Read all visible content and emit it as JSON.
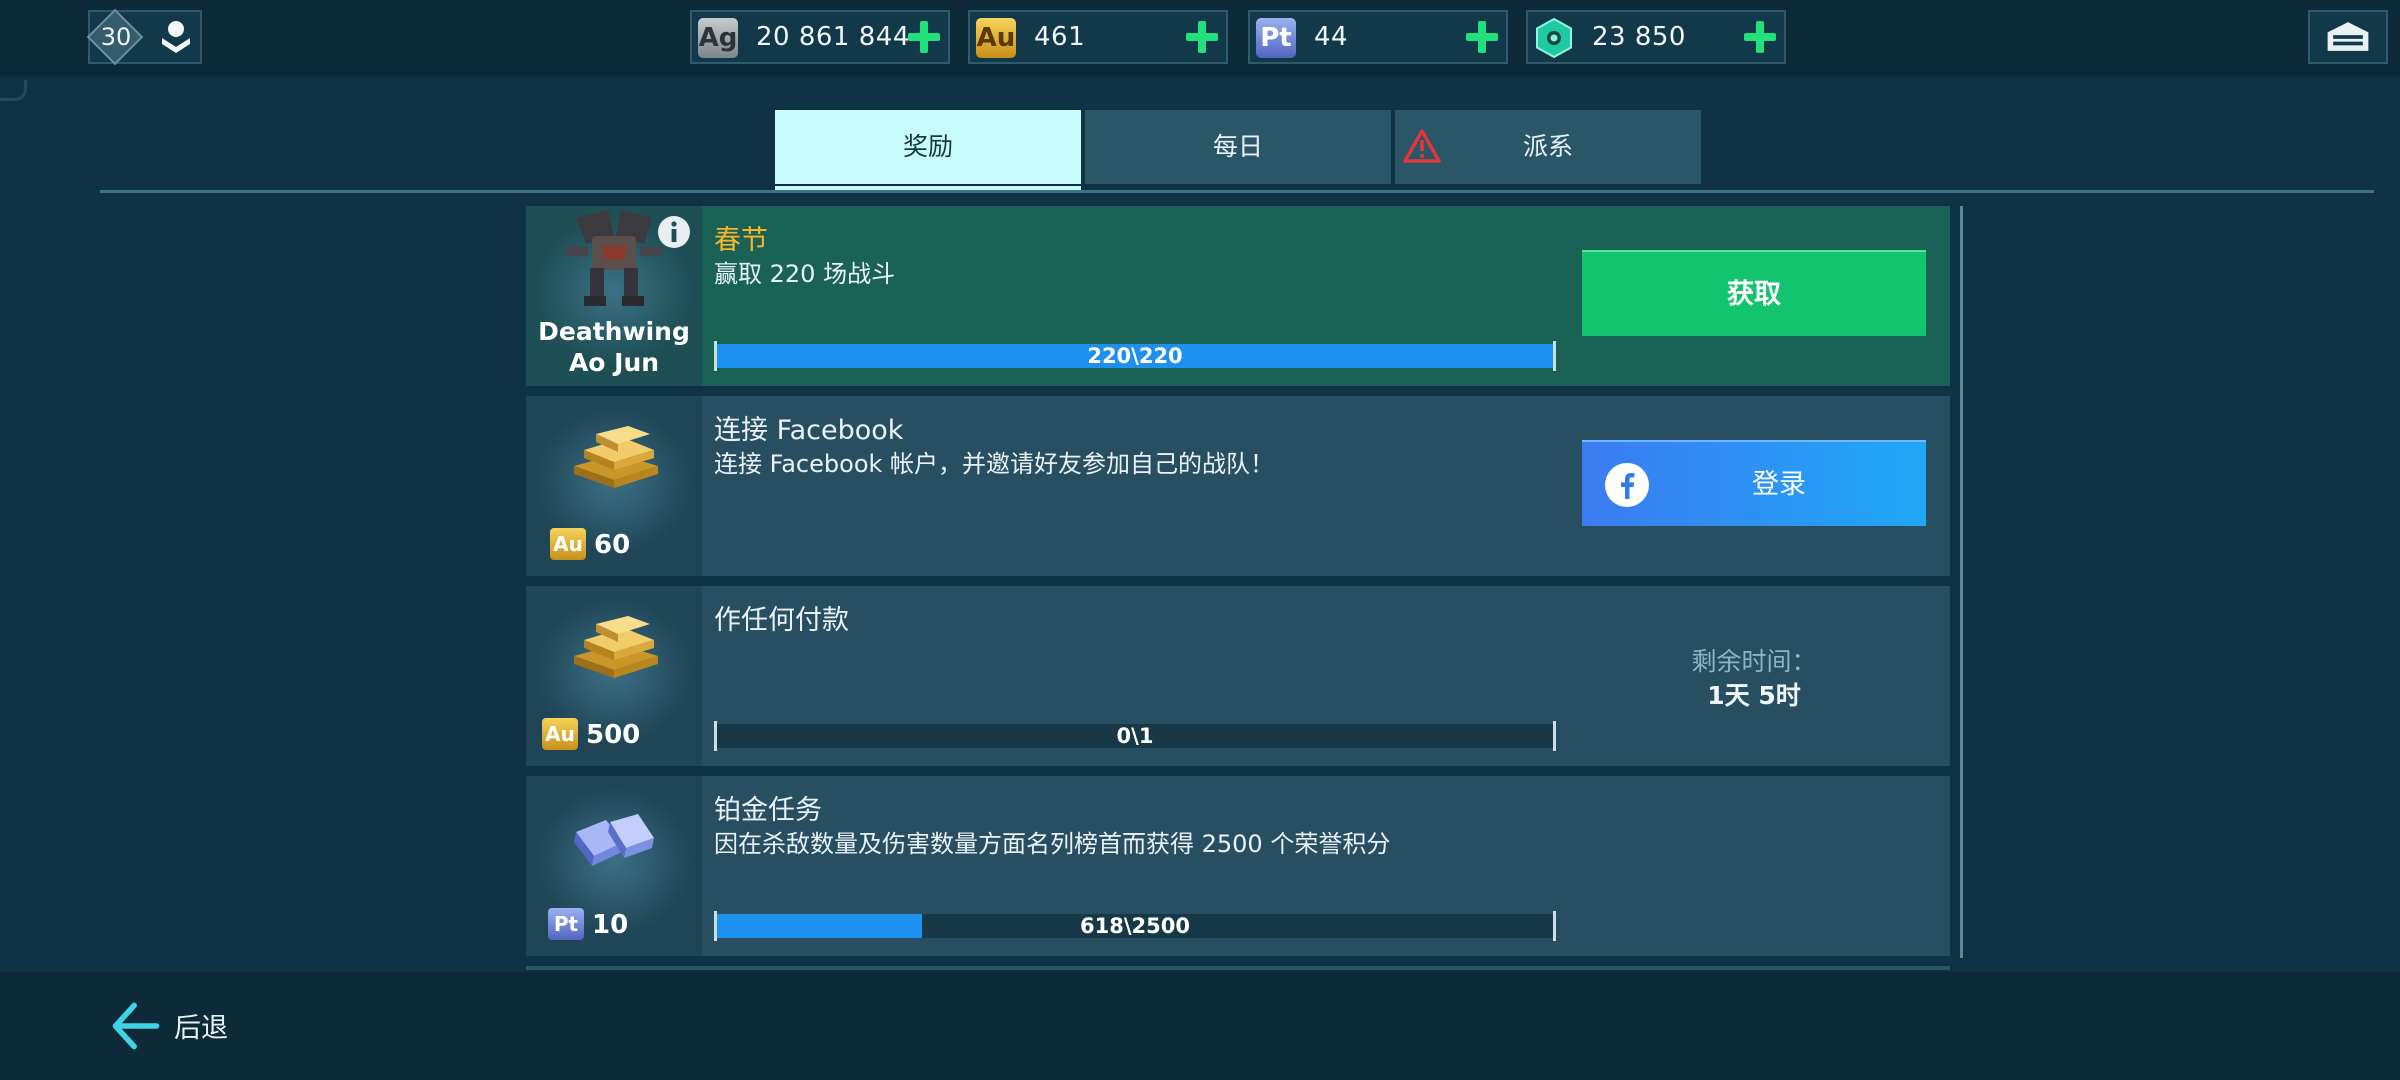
{
  "header": {
    "player_level": "30",
    "currencies": [
      {
        "name": "silver",
        "code": "Ag",
        "value": "20 861 844",
        "color": "#9aa3a8"
      },
      {
        "name": "gold",
        "code": "Au",
        "value": "461",
        "color": "#e3b21e"
      },
      {
        "name": "platinum",
        "code": "Pt",
        "value": "44",
        "color": "#6f86d6"
      },
      {
        "name": "components",
        "code": "",
        "value": "23 850",
        "color": "#1fc9a1"
      }
    ],
    "icons": [
      "profile-icon",
      "plus-icon",
      "hangar-icon"
    ]
  },
  "tabs": [
    {
      "label": "奖励",
      "active": true
    },
    {
      "label": "每日",
      "active": false
    },
    {
      "label": "派系",
      "active": false,
      "warning": true
    }
  ],
  "tasks": [
    {
      "title": "春节",
      "description": "赢取 220 场战斗",
      "reward_robot": "Deathwing Ao Jun",
      "progress_text": "220\\220",
      "progress": 1.0,
      "action_label": "获取"
    },
    {
      "title": "连接 Facebook",
      "description": "连接 Facebook 帐户，并邀请好友参加自己的战队！",
      "reward_code": "Au",
      "reward_amount": "60",
      "action_label": "登录"
    },
    {
      "title": "作任何付款",
      "description": "",
      "reward_code": "Au",
      "reward_amount": "500",
      "progress_text": "0\\1",
      "progress": 0.0,
      "timer_label": "剩余时间：",
      "timer_value": "1天 5时"
    },
    {
      "title": "铂金任务",
      "description": "因在杀敌数量及伤害数量方面名列榜首而获得 2500 个荣誉积分",
      "reward_code": "Pt",
      "reward_amount": "10",
      "progress_text": "618\\2500",
      "progress": 0.2472
    }
  ],
  "footer": {
    "back_label": "后退"
  },
  "colors": {
    "background": "#0f3344",
    "accent_green": "#12c46e",
    "progress_blue": "#1e90f0",
    "tab_active": "#c8fbfb",
    "gold_title": "#f5b52a"
  }
}
